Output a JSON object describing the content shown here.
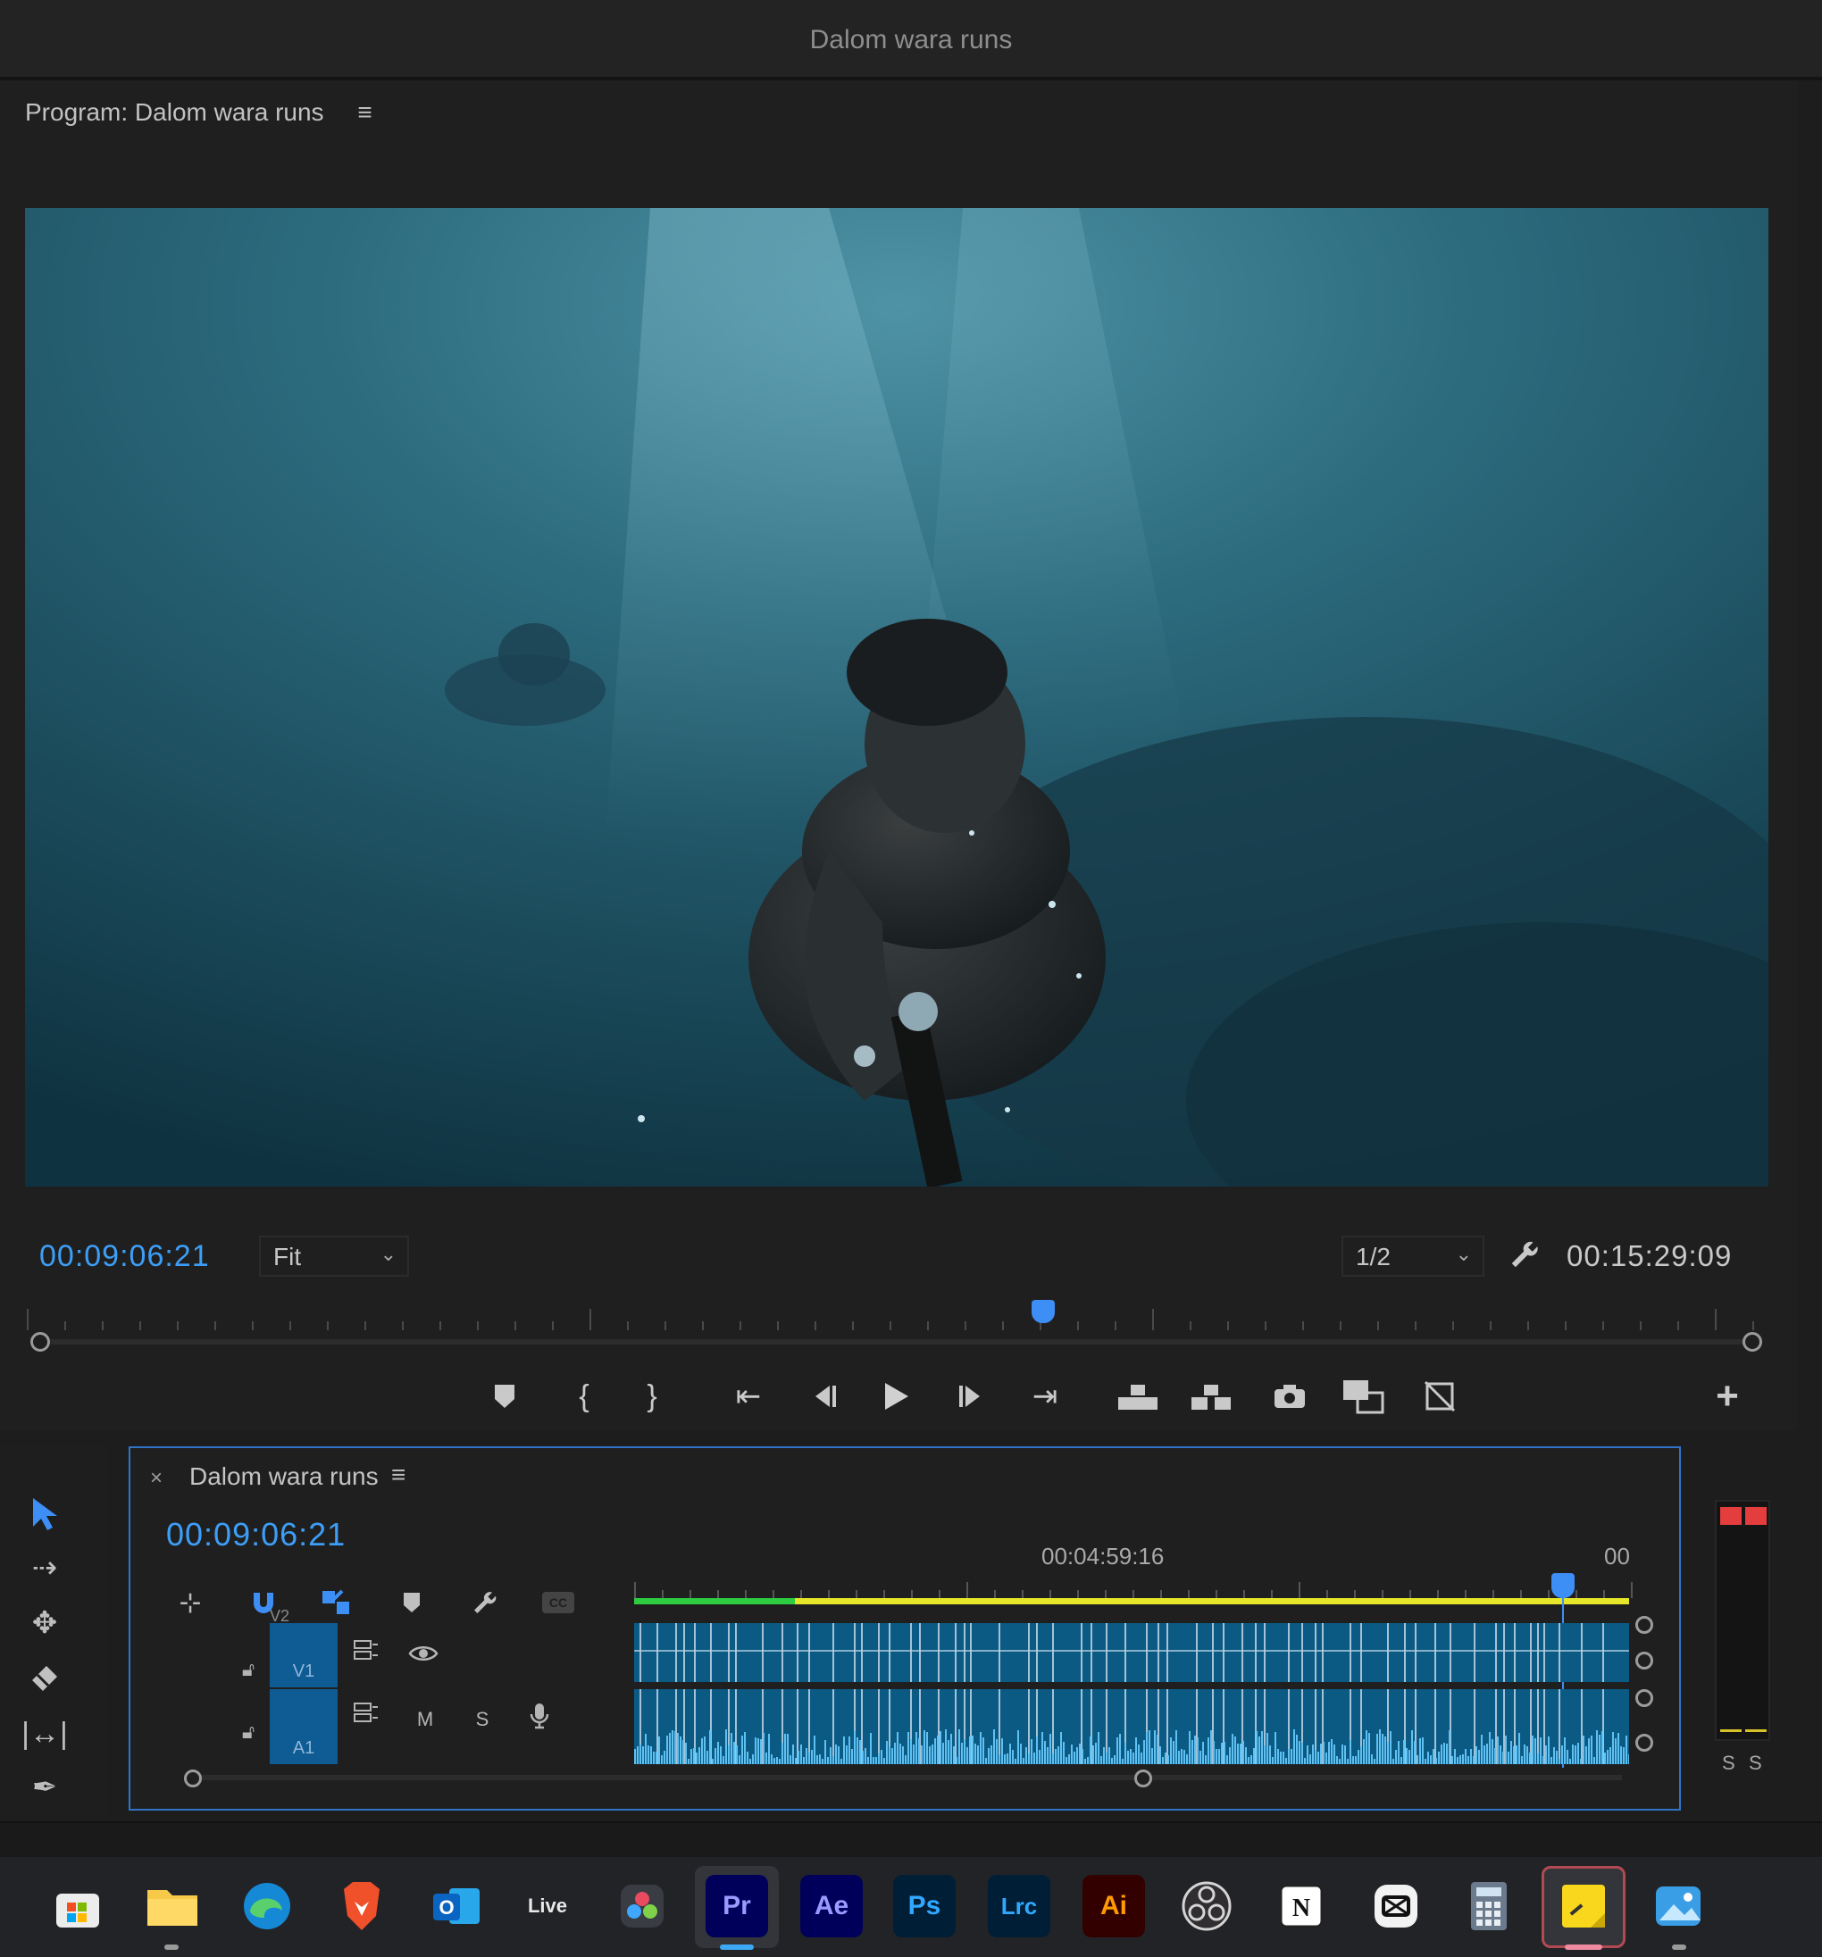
{
  "window": {
    "title": "Dalom wara runs"
  },
  "program_monitor": {
    "header": "Program: Dalom wara runs",
    "current_timecode": "00:09:06:21",
    "zoom_select": "Fit",
    "resolution_select": "1/2",
    "duration_timecode": "00:15:29:09"
  },
  "timeline": {
    "sequence_name": "Dalom wara runs",
    "current_timecode": "00:09:06:21",
    "ruler_label_mid": "00:04:59:16",
    "ruler_label_end": "00",
    "tracks": {
      "v2_label": "V2",
      "v1_label": "V1",
      "a1_label": "A1",
      "mute_label": "M",
      "solo_label": "S"
    }
  },
  "audio_meter": {
    "left_solo": "S",
    "right_solo": "S"
  },
  "taskbar": {
    "apps": [
      {
        "name": "microsoft-store",
        "label": ""
      },
      {
        "name": "file-explorer",
        "label": ""
      },
      {
        "name": "edge",
        "label": ""
      },
      {
        "name": "brave",
        "label": ""
      },
      {
        "name": "outlook",
        "label": "O"
      },
      {
        "name": "ableton-live",
        "label": "Live"
      },
      {
        "name": "davinci-resolve",
        "label": ""
      },
      {
        "name": "premiere-pro",
        "label": "Pr"
      },
      {
        "name": "after-effects",
        "label": "Ae"
      },
      {
        "name": "photoshop",
        "label": "Ps"
      },
      {
        "name": "lightroom-classic",
        "label": "Lrc"
      },
      {
        "name": "illustrator",
        "label": "Ai"
      },
      {
        "name": "obs",
        "label": ""
      },
      {
        "name": "notion",
        "label": "N"
      },
      {
        "name": "capcut",
        "label": ""
      },
      {
        "name": "calculator",
        "label": ""
      },
      {
        "name": "sticky-notes",
        "label": ""
      },
      {
        "name": "photos",
        "label": ""
      }
    ]
  },
  "colors": {
    "accent_blue": "#3d8ef5",
    "timecode_blue": "#3d9ef7",
    "render_bar_green": "#2ecc40",
    "render_bar_yellow": "#e6e62a",
    "clip_blue": "#0b5a84",
    "meter_peak_red": "#e43d3d"
  }
}
